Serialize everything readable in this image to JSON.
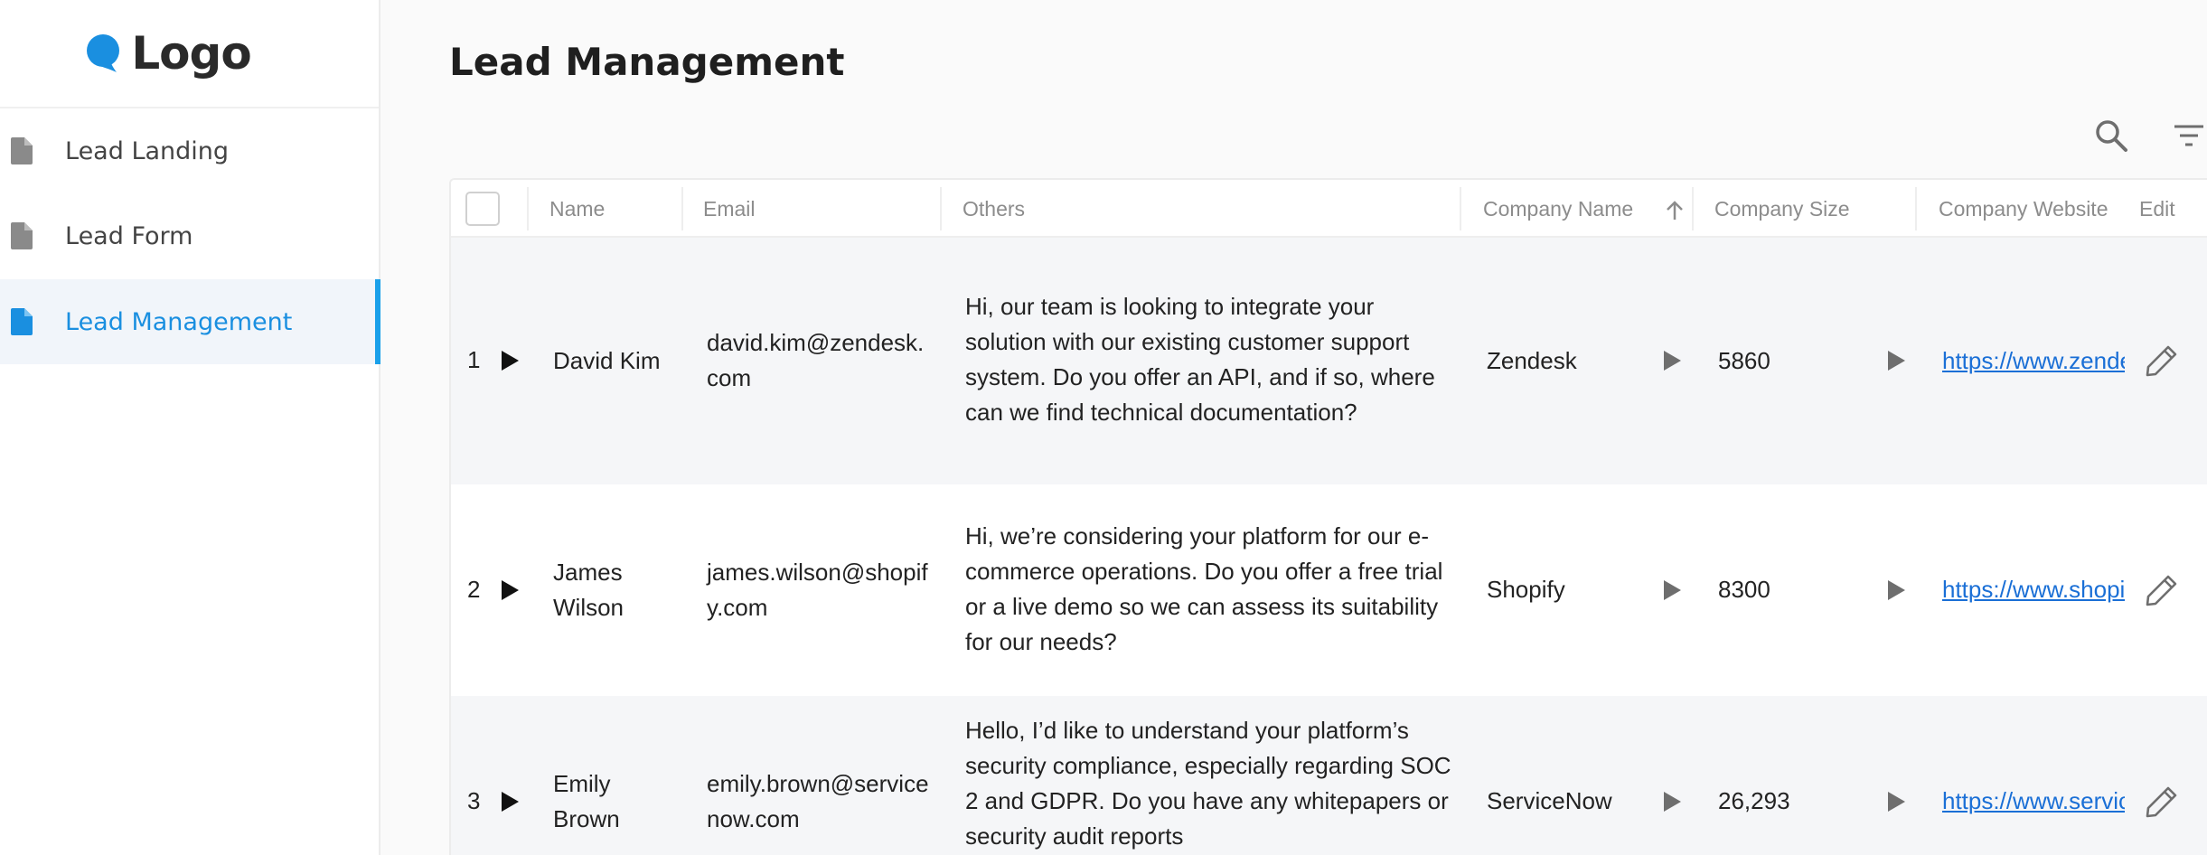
{
  "app": {
    "logo_text": "Logo"
  },
  "sidebar": {
    "items": [
      {
        "label": "Lead Landing",
        "active": false
      },
      {
        "label": "Lead Form",
        "active": false
      },
      {
        "label": "Lead Management",
        "active": true
      }
    ]
  },
  "page": {
    "title": "Lead Management"
  },
  "toolbar": {
    "search_icon": "search-icon",
    "filter_icon": "filter-icon"
  },
  "table": {
    "columns": {
      "name": "Name",
      "email": "Email",
      "others": "Others",
      "company_name": "Company Name",
      "company_size": "Company Size",
      "company_website": "Company Website",
      "edit": "Edit"
    },
    "sort": {
      "column": "company_name",
      "direction": "ascending"
    },
    "rows": [
      {
        "index": "1",
        "name": "David Kim",
        "email": "david.kim@zendesk.com",
        "others": "Hi, our team is looking to integrate your solution with our existing customer support system. Do you offer an API, and if so, where can we find technical documentation?",
        "company_name": "Zendesk",
        "company_size": "5860",
        "company_website": "https://www.zendesk.com"
      },
      {
        "index": "2",
        "name": "James Wilson",
        "email": "james.wilson@shopify.com",
        "others": "Hi, we’re considering your platform for our e-commerce operations. Do you offer a free trial or a live demo so we can assess its suitability for our needs?",
        "company_name": "Shopify",
        "company_size": "8300",
        "company_website": "https://www.shopify.com"
      },
      {
        "index": "3",
        "name": "Emily Brown",
        "email": "emily.brown@servicenow.com",
        "others": "Hello, I’d like to understand your platform’s security compliance, especially regarding SOC 2 and GDPR. Do you have any whitepapers or security audit reports",
        "company_name": "ServiceNow",
        "company_size": "26,293",
        "company_website": "https://www.servicenow.com"
      }
    ]
  },
  "colors": {
    "accent": "#1a8fe0",
    "link": "#1a6fd6",
    "row_alt": "#f5f6f8"
  }
}
